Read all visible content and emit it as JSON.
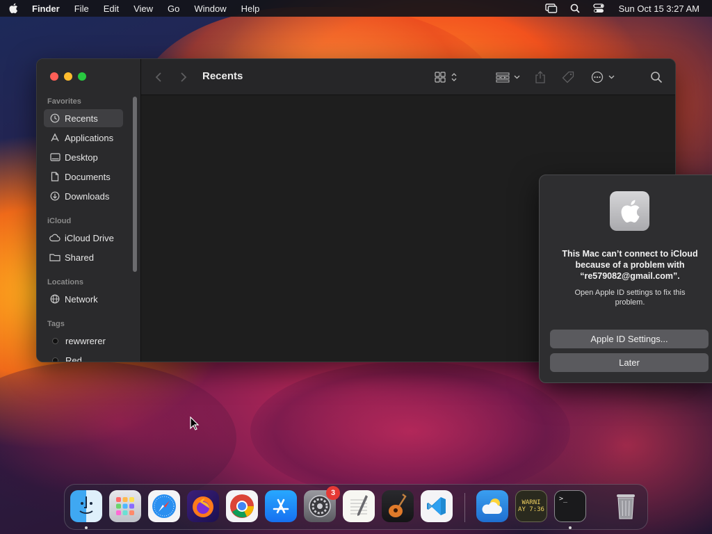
{
  "menubar": {
    "app_name": "Finder",
    "items": [
      "File",
      "Edit",
      "View",
      "Go",
      "Window",
      "Help"
    ],
    "clock": "Sun Oct 15  3:27 AM"
  },
  "finder": {
    "title": "Recents",
    "sidebar": {
      "favorites_label": "Favorites",
      "favorites": [
        "Recents",
        "Applications",
        "Desktop",
        "Documents",
        "Downloads"
      ],
      "icloud_label": "iCloud",
      "icloud": [
        "iCloud Drive",
        "Shared"
      ],
      "locations_label": "Locations",
      "locations": [
        "Network"
      ],
      "tags_label": "Tags",
      "tags": [
        "rewwrerer",
        "Red"
      ]
    }
  },
  "alert": {
    "title": "This Mac can’t connect to iCloud because of a problem with “re579082@gmail.com”.",
    "message": "Open Apple ID settings to fix this problem.",
    "primary_button": "Apple ID Settings...",
    "secondary_button": "Later"
  },
  "dock": {
    "settings_badge": "3",
    "console_text_1": "WARNI",
    "console_text_2": "AY 7:36",
    "terminal_prompt": ">_"
  }
}
